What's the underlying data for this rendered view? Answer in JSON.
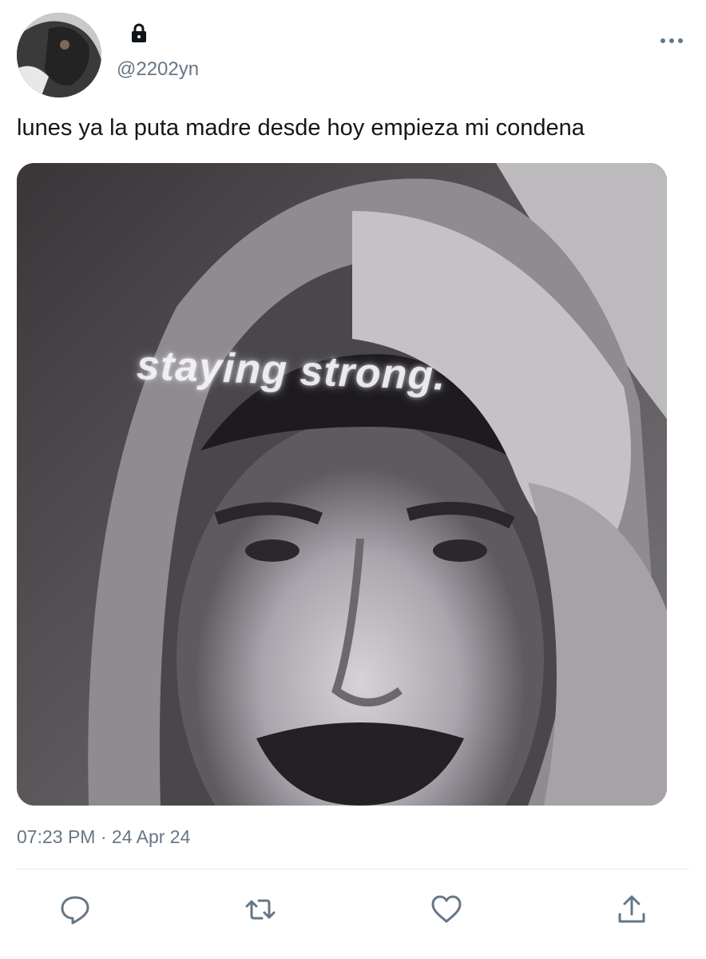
{
  "tweet": {
    "handle": "@2202yn",
    "protected_icon": "lock-icon",
    "text": "lunes ya la puta madre desde hoy empieza mi condena",
    "media_caption": "staying strong.",
    "timestamp": "07:23 PM",
    "separator": "·",
    "date": "24 Apr 24"
  },
  "header": {
    "more_icon": "more-horizontal-icon"
  },
  "actions": [
    {
      "icon": "reply-icon"
    },
    {
      "icon": "retweet-icon"
    },
    {
      "icon": "like-icon"
    },
    {
      "icon": "share-icon"
    }
  ],
  "colors": {
    "secondary_text": "#657786",
    "primary_text": "#14171a",
    "divider": "#e1e8ed",
    "icon": "#657786"
  }
}
